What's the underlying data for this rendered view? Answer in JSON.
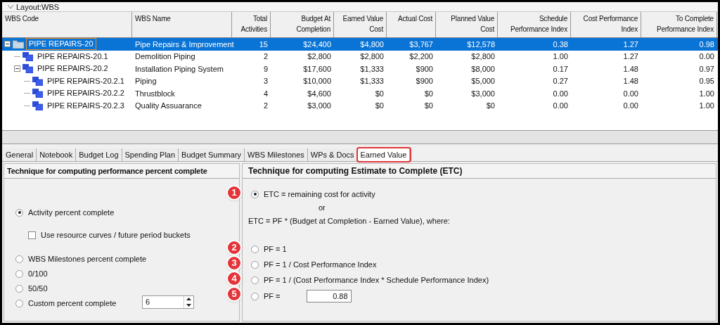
{
  "layout_bar": {
    "label": "Layout:WBS"
  },
  "table": {
    "columns": [
      "WBS Code",
      "WBS Name",
      "Total Activities",
      "Budget At Completion",
      "Earned Value Cost",
      "Actual Cost",
      "Planned Value Cost",
      "Schedule Performance Index",
      "Cost Performance Index",
      "To Complete Performance Index"
    ],
    "rows": [
      {
        "kind": "folder",
        "code": "PIPE REPAIRS-20",
        "name": "Pipe Repairs & Improvement",
        "values": [
          "15",
          "$24,400",
          "$4,800",
          "$3,767",
          "$12,578",
          "0.38",
          "1.27",
          "0.98"
        ],
        "selected": true,
        "expanded": true,
        "children": [
          {
            "kind": "wbs",
            "code": "PIPE REPAIRS-20.1",
            "name": "Demolition Piping",
            "values": [
              "2",
              "$2,800",
              "$2,800",
              "$2,200",
              "$2,800",
              "1.00",
              "1.27",
              "0.00"
            ],
            "selected": false
          },
          {
            "kind": "wbs",
            "code": "PIPE REPAIRS-20.2",
            "name": "Installation Piping System",
            "values": [
              "9",
              "$17,600",
              "$1,333",
              "$900",
              "$8,000",
              "0.17",
              "1.48",
              "0.97"
            ],
            "selected": false,
            "expanded": true,
            "children": [
              {
                "kind": "wbs",
                "code": "PIPE REPAIRS-20.2.1",
                "name": "Piping",
                "values": [
                  "3",
                  "$10,000",
                  "$1,333",
                  "$900",
                  "$5,000",
                  "0.27",
                  "1.48",
                  "0.95"
                ],
                "selected": false
              },
              {
                "kind": "wbs",
                "code": "PIPE REPAIRS-20.2.2",
                "name": "Thrustblock",
                "values": [
                  "4",
                  "$4,600",
                  "$0",
                  "$0",
                  "$3,000",
                  "0.00",
                  "0.00",
                  "1.00"
                ],
                "selected": false
              },
              {
                "kind": "wbs",
                "code": "PIPE REPAIRS-20.2.3",
                "name": "Quality Assuarance",
                "values": [
                  "2",
                  "$3,000",
                  "$0",
                  "$0",
                  "$0",
                  "0.00",
                  "0.00",
                  "1.00"
                ],
                "selected": false
              }
            ]
          }
        ]
      }
    ]
  },
  "tabs": [
    {
      "label": "General",
      "selected": false
    },
    {
      "label": "Notebook",
      "selected": false
    },
    {
      "label": "Budget Log",
      "selected": false
    },
    {
      "label": "Spending Plan",
      "selected": false
    },
    {
      "label": "Budget Summary",
      "selected": false
    },
    {
      "label": "WBS Milestones",
      "selected": false
    },
    {
      "label": "WPs & Docs",
      "selected": false
    },
    {
      "label": "Earned Value",
      "selected": true,
      "highlighted": true
    }
  ],
  "left_panel": {
    "title": "Technique for computing performance percent complete",
    "options": [
      {
        "kind": "radio",
        "label": "Activity percent complete",
        "selected": true
      },
      {
        "kind": "checkbox",
        "label": "Use resource curves / future period buckets",
        "checked": false
      },
      {
        "kind": "radio",
        "label": "WBS Milestones percent complete",
        "selected": false
      },
      {
        "kind": "radio",
        "label": "0/100",
        "selected": false
      },
      {
        "kind": "radio",
        "label": "50/50",
        "selected": false
      },
      {
        "kind": "radio",
        "label": "Custom percent complete",
        "selected": false,
        "spin_value": "6"
      }
    ]
  },
  "right_panel": {
    "title": "Technique for computing Estimate to Complete (ETC)",
    "options": [
      {
        "kind": "radio",
        "badge": "1",
        "label": "ETC = remaining cost for activity",
        "selected": true
      },
      {
        "kind": "text",
        "label": "or"
      },
      {
        "kind": "text",
        "label": "ETC = PF * (Budget at Completion - Earned Value), where:"
      },
      {
        "kind": "radio",
        "badge": "2",
        "label": "PF = 1",
        "selected": false
      },
      {
        "kind": "radio",
        "badge": "3",
        "label": "PF = 1 / Cost Performance Index",
        "selected": false
      },
      {
        "kind": "radio",
        "badge": "4",
        "label": "PF = 1 / (Cost Performance Index * Schedule Performance Index)",
        "selected": false
      },
      {
        "kind": "radio",
        "badge": "5",
        "label": "PF =",
        "selected": false,
        "field_value": "0.88"
      }
    ]
  }
}
